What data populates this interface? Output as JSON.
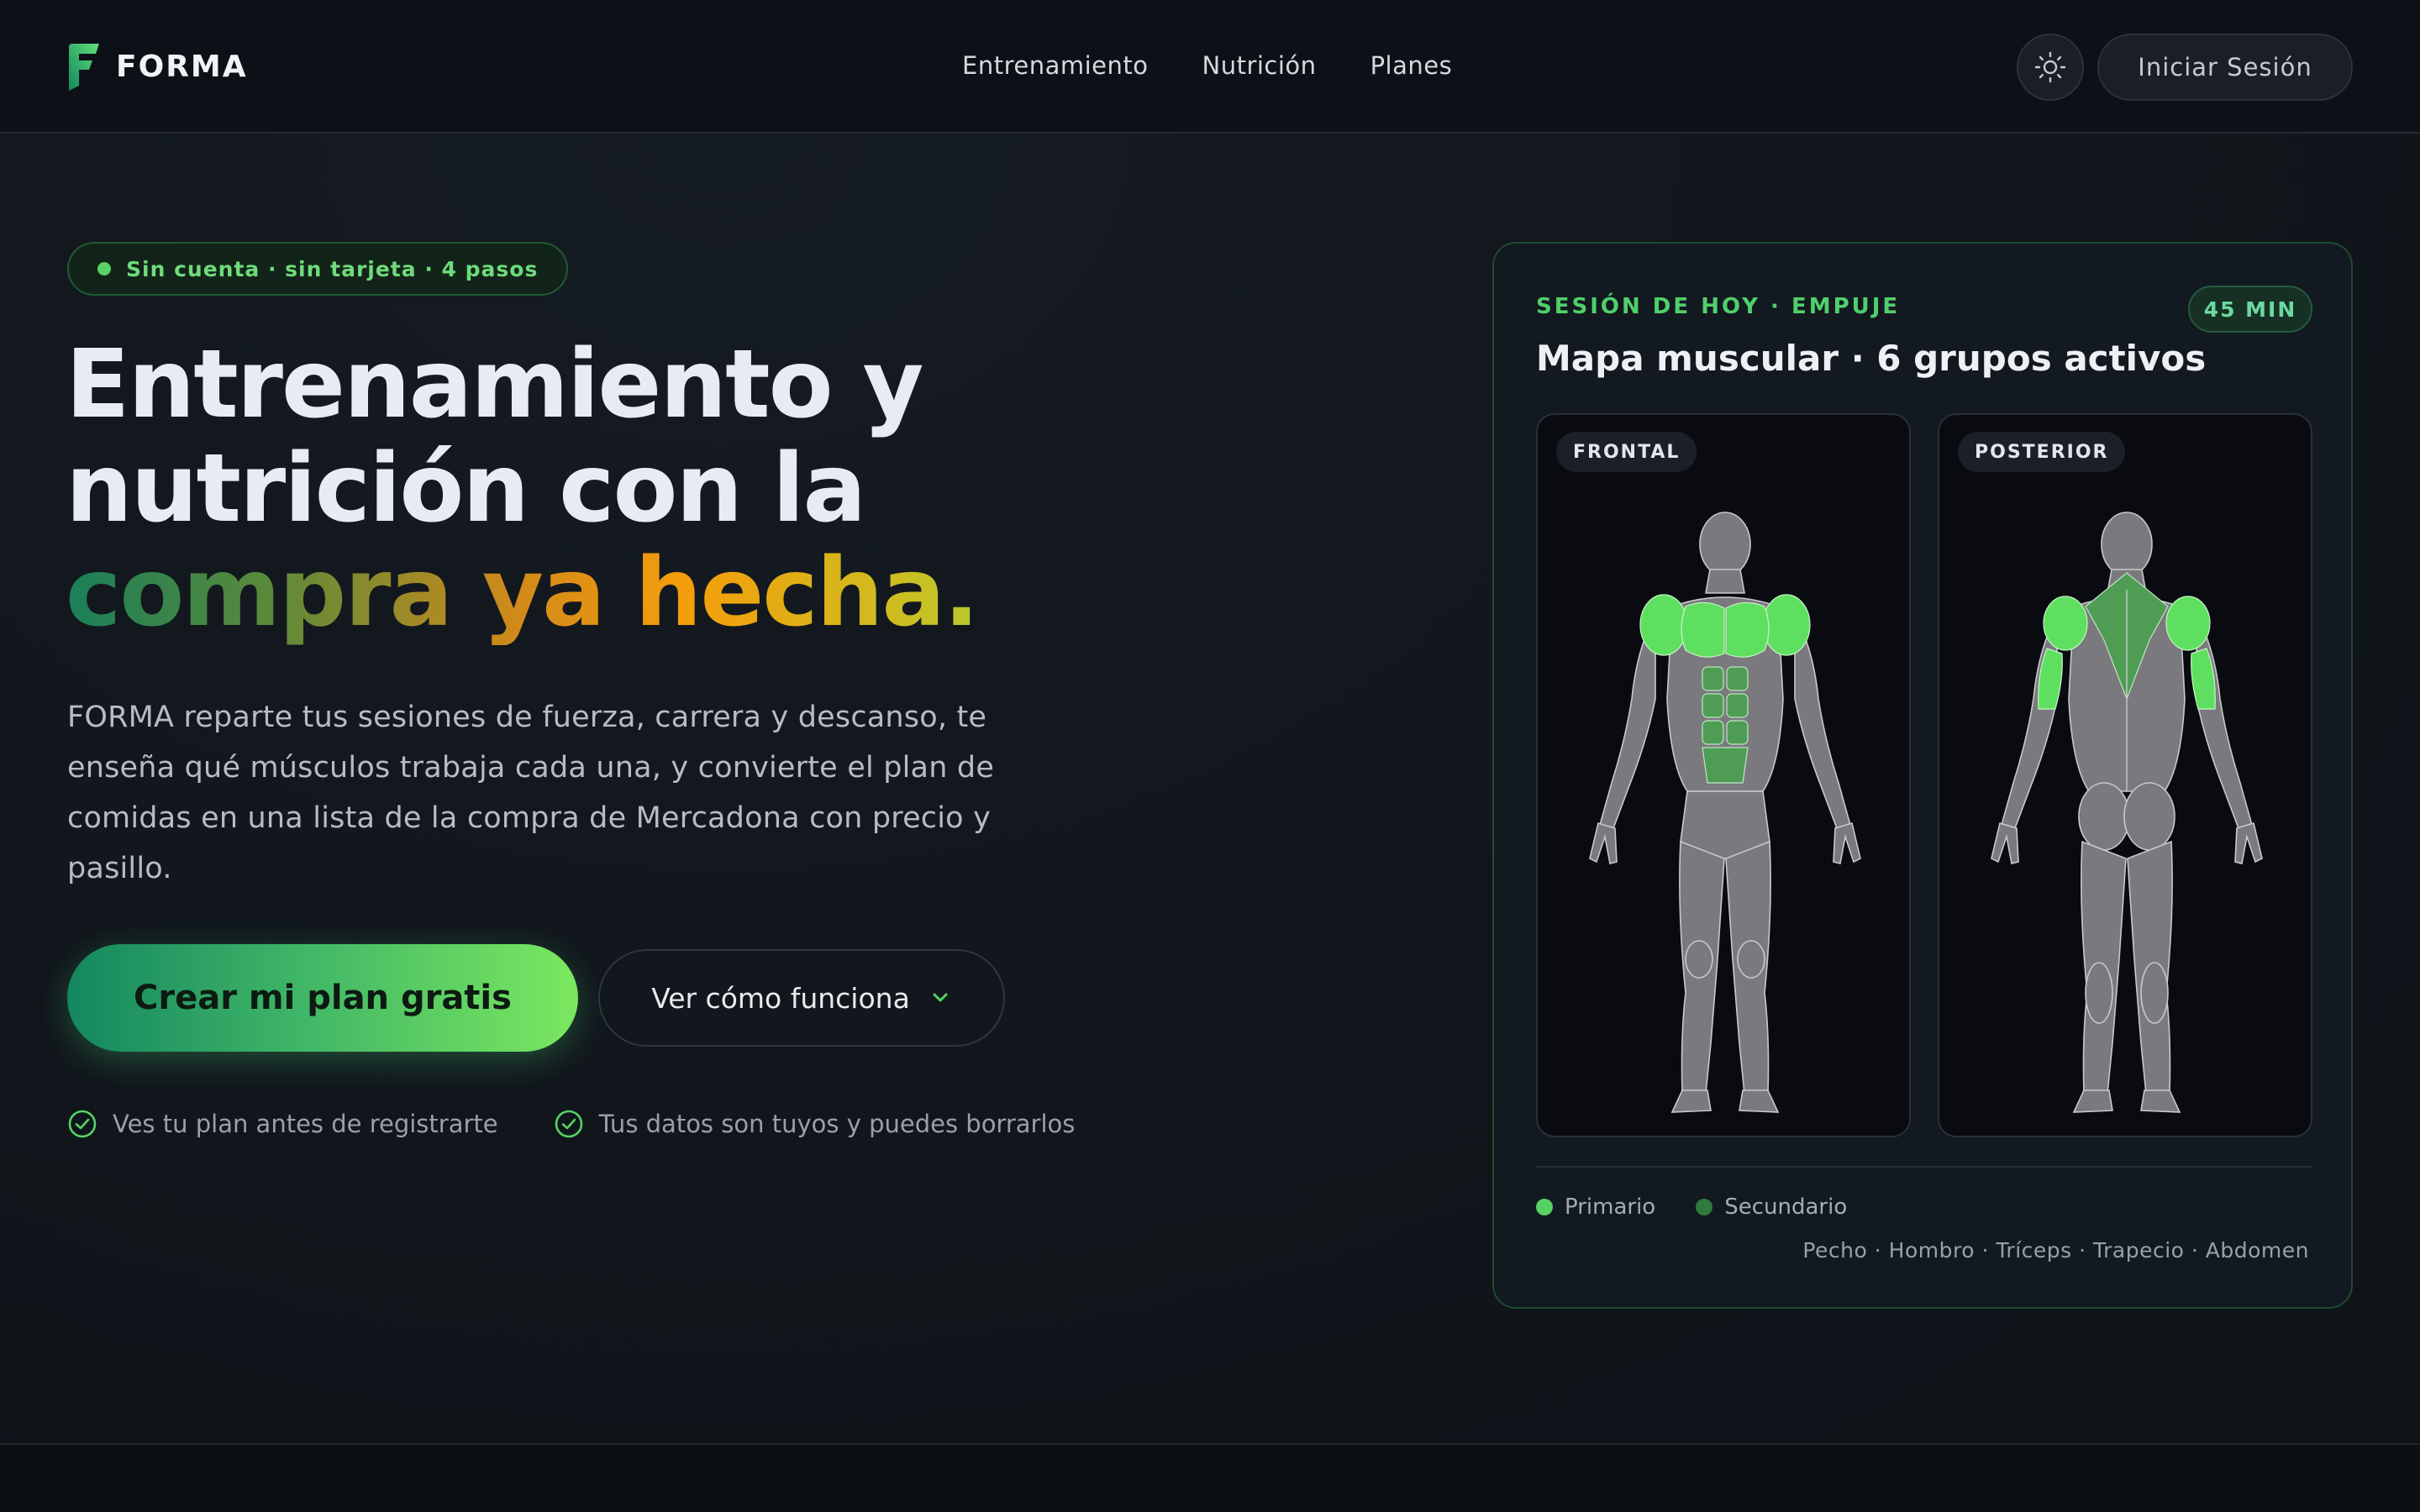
{
  "brand": {
    "name": "FORMA",
    "logo_icon": "forma-f-logo",
    "accent": "#56d364"
  },
  "nav": {
    "links": [
      "Entrenamiento",
      "Nutrición",
      "Planes"
    ],
    "theme_icon": "sun-icon",
    "login_label": "Iniciar Sesión"
  },
  "hero": {
    "badge": "Sin cuenta · sin tarjeta · 4 pasos",
    "headline_line1": "Entrenamiento y",
    "headline_line2": "nutrición con la",
    "headline_line3": "compra ya hecha.",
    "lead": "FORMA reparte tus sesiones de fuerza, carrera y descanso, te enseña qué músculos trabaja cada una, y convierte el plan de comidas en una lista de la compra de Mercadona con precio y pasillo.",
    "cta_primary": "Crear mi plan gratis",
    "cta_secondary": "Ver cómo funciona",
    "checks": [
      "Ves tu plan antes de registrarte",
      "Tus datos son tuyos y puedes borrarlos"
    ]
  },
  "session": {
    "kicker": "SESIÓN DE HOY · EMPUJE",
    "duration": "45 MIN",
    "title": "Mapa muscular · 6 grupos activos",
    "front_label": "FRONTAL",
    "back_label": "POSTERIOR",
    "legend_primary": "Primario",
    "legend_secondary": "Secundario",
    "muscles": "Pecho · Hombro · Tríceps · Trapecio · Abdomen",
    "colors": {
      "primary": "#56d364",
      "secondary": "#2f7a3e",
      "inactive": "#7a7a7e"
    }
  }
}
